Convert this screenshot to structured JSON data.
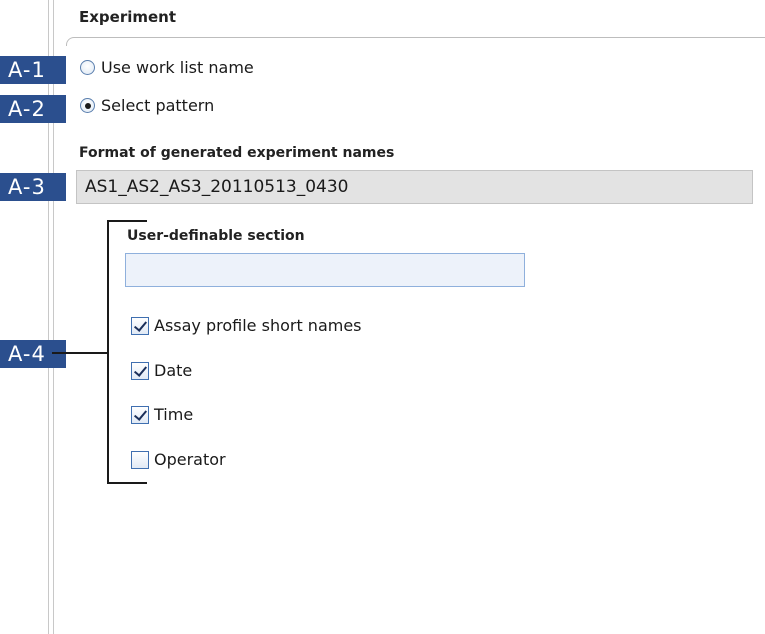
{
  "group": {
    "title": "Experiment"
  },
  "callouts": {
    "a1": "A-1",
    "a2": "A-2",
    "a3": "A-3",
    "a4": "A-4"
  },
  "naming_options": [
    {
      "label": "Use work list name",
      "selected": false
    },
    {
      "label": "Select pattern",
      "selected": true
    }
  ],
  "format": {
    "label": "Format of generated experiment names",
    "value": "AS1_AS2_AS3_20110513_0430"
  },
  "user_definable": {
    "label": "User-definable section",
    "value": "",
    "placeholder": ""
  },
  "components": [
    {
      "label": "Assay profile short names",
      "checked": true
    },
    {
      "label": "Date",
      "checked": true
    },
    {
      "label": "Time",
      "checked": true
    },
    {
      "label": "Operator",
      "checked": false
    }
  ],
  "colors": {
    "callout_bg": "#2b4f8e",
    "field_bg": "#e3e3e3",
    "input_border": "#8fb0dc"
  }
}
